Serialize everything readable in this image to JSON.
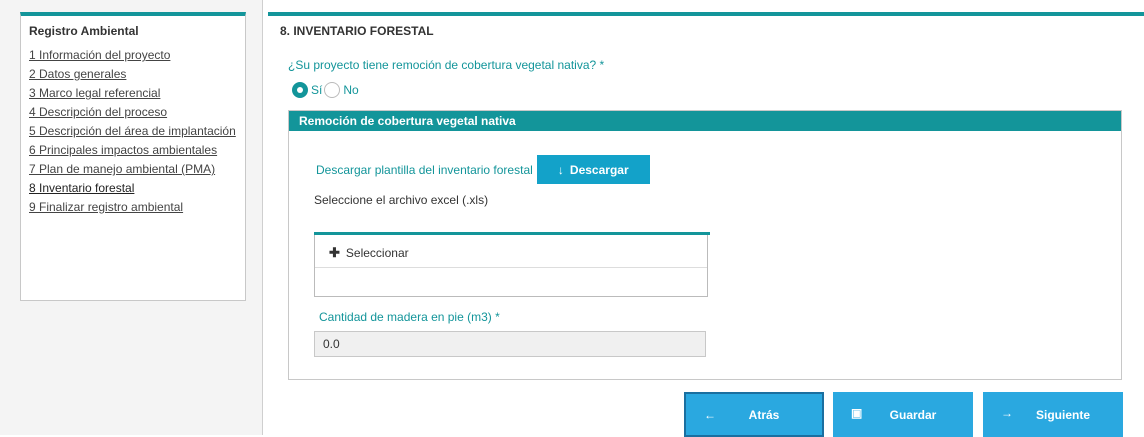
{
  "sidebar": {
    "title": "Registro Ambiental",
    "items": [
      {
        "label": "1 Información del proyecto"
      },
      {
        "label": "2 Datos generales"
      },
      {
        "label": "3 Marco legal referencial"
      },
      {
        "label": "4 Descripción del proceso"
      },
      {
        "label": "5 Descripción del área de implantación"
      },
      {
        "label": "6 Principales impactos ambientales"
      },
      {
        "label": "7 Plan de manejo ambiental (PMA)"
      },
      {
        "label": "8 Inventario forestal"
      },
      {
        "label": "9 Finalizar registro ambiental"
      }
    ]
  },
  "main": {
    "section_title": "8. INVENTARIO FORESTAL",
    "question": "¿Su proyecto tiene remoción de cobertura vegetal nativa? *",
    "radio_yes": "Sí",
    "radio_no": "No",
    "panel": {
      "title": "Remoción de cobertura vegetal nativa",
      "download_text": "Descargar plantilla del inventario forestal",
      "download_button": "Descargar",
      "file_label": "Seleccione el archivo excel (.xls)",
      "select_button": "Seleccionar",
      "quantity_label": "Cantidad de madera en pie (m3) *",
      "quantity_value": "0.0"
    }
  },
  "buttons": {
    "back": "Atrás",
    "save": "Guardar",
    "next": "Siguiente"
  },
  "colors": {
    "accent": "#13959a",
    "button_blue": "#2aa8e0",
    "download_blue": "#13a2c9"
  },
  "icons": {
    "download": "arrow-down-icon",
    "select": "plus-icon",
    "back": "arrow-left-icon",
    "save": "floppy-icon",
    "next": "arrow-right-icon"
  }
}
